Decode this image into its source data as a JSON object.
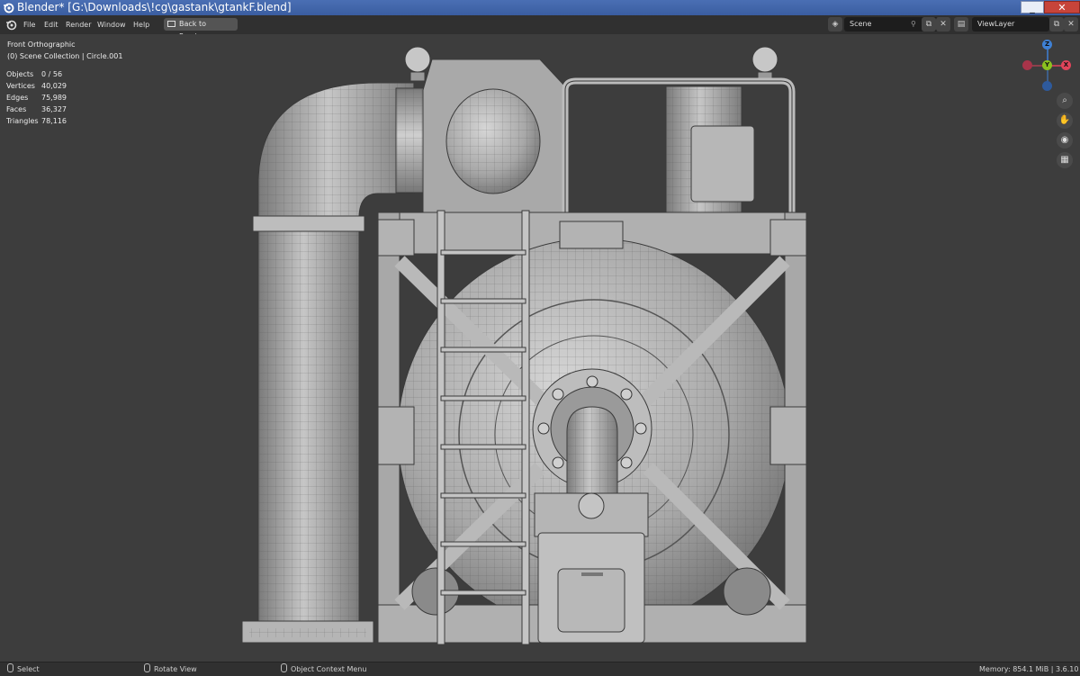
{
  "window": {
    "title": "Blender* [G:\\Downloads\\!cg\\gastank\\gtankF.blend]",
    "minimize_label": "_",
    "maximize_label": "□",
    "close_label": "✕"
  },
  "menubar": {
    "items": [
      "File",
      "Edit",
      "Render",
      "Window",
      "Help"
    ],
    "back_button": "Back to Previous",
    "scene": "Scene",
    "view_layer": "ViewLayer"
  },
  "viewport": {
    "view_name": "Front Orthographic",
    "collection": "(0) Scene Collection | Circle.001",
    "stats": [
      {
        "label": "Objects",
        "value": "0 / 56"
      },
      {
        "label": "Vertices",
        "value": "40,029"
      },
      {
        "label": "Edges",
        "value": "75,989"
      },
      {
        "label": "Faces",
        "value": "36,327"
      },
      {
        "label": "Triangles",
        "value": "78,116"
      }
    ],
    "gizmo": {
      "z": "Z",
      "y": "Y",
      "x": "X"
    }
  },
  "statusbar": {
    "select": "Select",
    "rotate": "Rotate View",
    "context": "Object Context Menu",
    "memory": "Memory: 854.1 MiB | 3.6.10"
  },
  "colors": {
    "accent": "#4772b3",
    "axis_x": "#e0445a",
    "axis_y": "#8bc21f",
    "axis_z": "#3e80d4",
    "viewport_bg": "#3d3d3d"
  }
}
